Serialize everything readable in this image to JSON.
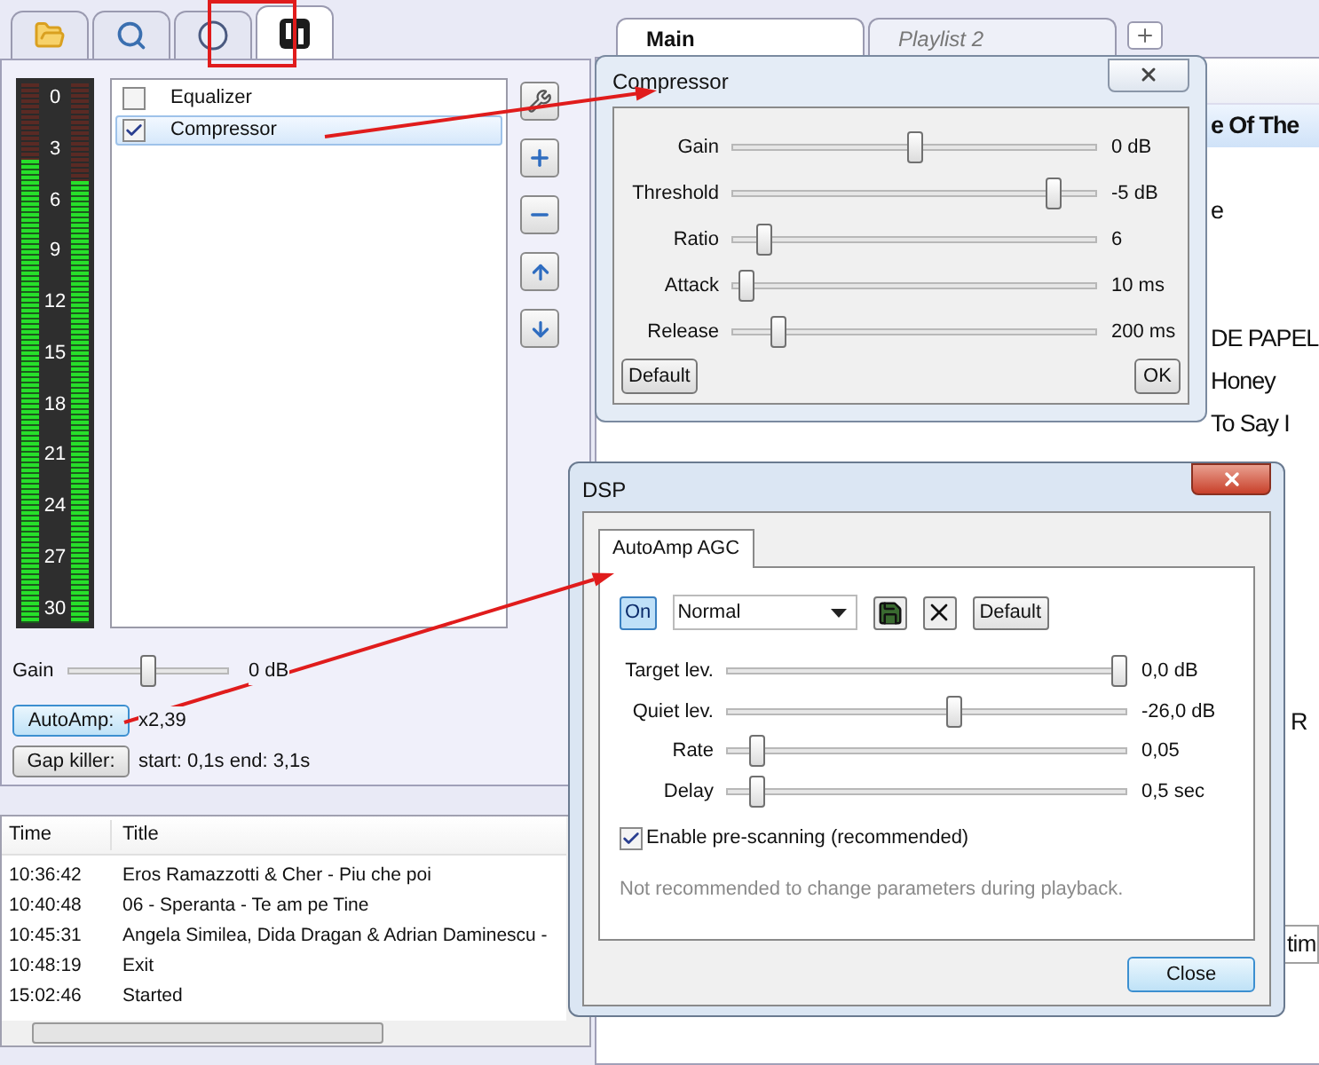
{
  "left_tabs": [
    {
      "kind": "folder",
      "selected": false
    },
    {
      "kind": "search",
      "selected": false
    },
    {
      "kind": "clock",
      "selected": false
    },
    {
      "kind": "dsp",
      "selected": true
    }
  ],
  "meter": {
    "scale": [
      "0",
      "3",
      "6",
      "9",
      "12",
      "15",
      "18",
      "21",
      "24",
      "27",
      "30"
    ],
    "channels": [
      {
        "level": 0.86
      },
      {
        "level": 0.82
      }
    ]
  },
  "dsp_list": [
    {
      "label": "Equalizer",
      "checked": false,
      "selected": false
    },
    {
      "label": "Compressor",
      "checked": true,
      "selected": true
    }
  ],
  "side_buttons": [
    {
      "kind": "tools"
    },
    {
      "kind": "add"
    },
    {
      "kind": "remove"
    },
    {
      "kind": "up"
    },
    {
      "kind": "down"
    }
  ],
  "gain": {
    "label": "Gain",
    "level": 0.5,
    "reading": "0 dB"
  },
  "autoamp": {
    "button": "AutoAmp:",
    "reading": "x2,39"
  },
  "gap_killer": {
    "button": "Gap killer:",
    "reading": "start: 0,1s end: 3,1s"
  },
  "log": {
    "columns": [
      "Time",
      "Title"
    ],
    "rows": [
      {
        "time": "10:36:42",
        "title": "Eros Ramazzotti & Cher - Piu che poi"
      },
      {
        "time": "10:40:48",
        "title": "06 - Speranta - Te am pe Tine"
      },
      {
        "time": "10:45:31",
        "title": "Angela Similea, Dida Dragan & Adrian Daminescu -"
      },
      {
        "time": "10:48:19",
        "title": "Exit"
      },
      {
        "time": "15:02:46",
        "title": "Started"
      }
    ]
  },
  "playlist_tabs": [
    {
      "label": "Main",
      "selected": true
    },
    {
      "label": "Playlist 2",
      "selected": false
    }
  ],
  "playlist": {
    "rows": [
      {
        "kind": "title",
        "text": "e Of The",
        "selected": true
      },
      {
        "selected": false
      },
      {
        "kind": "title",
        "text": "e",
        "selected": false
      },
      {
        "selected": false
      },
      {
        "selected": false
      },
      {
        "kind": "title",
        "text": "DE PAPEL",
        "selected": false
      },
      {
        "kind": "title",
        "text": "Honey",
        "selected": false
      },
      {
        "kind": "title",
        "text": "To Say I",
        "selected": false
      },
      {
        "selected": false
      },
      {
        "selected": false
      },
      {
        "selected": false
      },
      {
        "selected": false
      },
      {
        "selected": false
      },
      {
        "selected": false
      },
      {
        "kind": "tail",
        "text": "R",
        "selected": false
      }
    ],
    "bottom_field": "tim"
  },
  "compressor": {
    "title": "Compressor",
    "sliders": [
      {
        "label": "Gain",
        "level": 0.5,
        "reading": "0 dB"
      },
      {
        "label": "Threshold",
        "level": 0.9,
        "reading": "-5 dB"
      },
      {
        "label": "Ratio",
        "level": 0.07,
        "reading": "6"
      },
      {
        "label": "Attack",
        "level": 0.02,
        "reading": "10 ms"
      },
      {
        "label": "Release",
        "level": 0.11,
        "reading": "200 ms"
      }
    ],
    "default_button": "Default",
    "ok_button": "OK"
  },
  "dsp": {
    "title": "DSP",
    "tabs": [
      {
        "label": "AutoAmp AGC",
        "selected": true
      }
    ],
    "toggle": {
      "label": "On",
      "on": true
    },
    "preset": "Normal",
    "default_button": "Default",
    "sliders": [
      {
        "label": "Target lev.",
        "level": 1.0,
        "reading": "0,0 dB"
      },
      {
        "label": "Quiet lev.",
        "level": 0.57,
        "reading": "-26,0 dB"
      },
      {
        "label": "Rate",
        "level": 0.06,
        "reading": "0,05"
      },
      {
        "label": "Delay",
        "level": 0.06,
        "reading": "0,5 sec"
      }
    ],
    "prescan": {
      "label": "Enable pre-scanning (recommended)",
      "checked": true
    },
    "note": "Not recommended to change parameters during playback.",
    "close_button": "Close"
  }
}
